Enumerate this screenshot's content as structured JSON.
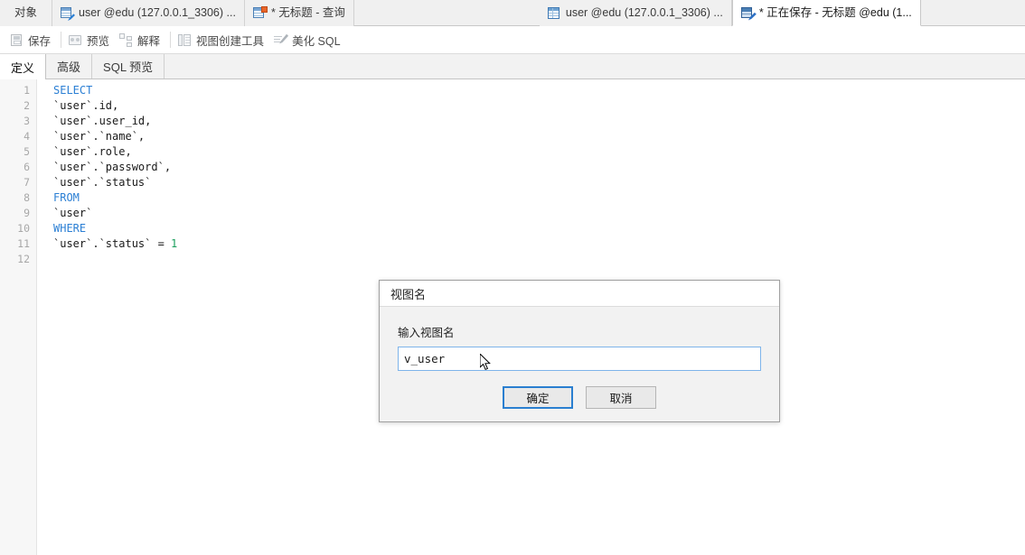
{
  "window": {
    "tabs": [
      {
        "label": "对象",
        "icon": "none",
        "active": false,
        "first": true
      },
      {
        "label": "user @edu (127.0.0.1_3306) ...",
        "icon": "table-pencil-icon",
        "active": false
      },
      {
        "label": "* 无标题 - 查询",
        "icon": "query-icon",
        "active": false
      },
      {
        "label": "user @edu (127.0.0.1_3306) ...",
        "icon": "table-icon",
        "active": false
      },
      {
        "label": "* 正在保存 - 无标题 @edu (1...",
        "icon": "saving-icon",
        "active": true
      }
    ]
  },
  "toolbar": {
    "items": [
      {
        "label": "保存",
        "icon": "save-icon"
      },
      {
        "label": "预览",
        "icon": "preview-icon"
      },
      {
        "label": "解释",
        "icon": "explain-icon"
      },
      {
        "label": "视图创建工具",
        "icon": "view-builder-icon"
      },
      {
        "label": "美化 SQL",
        "icon": "beautify-icon"
      }
    ]
  },
  "subtabs": [
    {
      "label": "定义",
      "active": true
    },
    {
      "label": "高级",
      "active": false
    },
    {
      "label": "SQL 预览",
      "active": false
    }
  ],
  "editor": {
    "line_numbers": [
      "1",
      "2",
      "3",
      "4",
      "5",
      "6",
      "7",
      "8",
      "9",
      "10",
      "11",
      "12"
    ],
    "lines": [
      {
        "text": "SELECT",
        "type": "keyword"
      },
      {
        "text": "`user`.id,",
        "type": "plain"
      },
      {
        "text": "`user`.user_id,",
        "type": "plain"
      },
      {
        "text": "`user`.`name`,",
        "type": "plain"
      },
      {
        "text": "`user`.role,",
        "type": "plain"
      },
      {
        "text": "`user`.`password`,",
        "type": "plain"
      },
      {
        "text": "`user`.`status`",
        "type": "plain"
      },
      {
        "text": "FROM",
        "type": "keyword"
      },
      {
        "text": "`user`",
        "type": "plain"
      },
      {
        "text": "WHERE",
        "type": "keyword"
      },
      {
        "text": "`user`.`status` = 1",
        "type": "mixed",
        "numeric": "1"
      },
      {
        "text": "",
        "type": "plain"
      }
    ],
    "full_sql": "SELECT\n`user`.id,\n`user`.user_id,\n`user`.`name`,\n`user`.role,\n`user`.`password`,\n`user`.`status`\nFROM\n`user`\nWHERE\n`user`.`status` = 1"
  },
  "dialog": {
    "title": "视图名",
    "label": "输入视图名",
    "input_value": "v_user",
    "input_placeholder": "",
    "ok_label": "确定",
    "cancel_label": "取消"
  },
  "colors": {
    "keyword": "#2b7fd4",
    "number": "#1a9e5c",
    "accent": "#2a7fd0",
    "input_border": "#7eb4ea",
    "tab_active_bg": "#ffffff",
    "chrome_bg": "#f0f0f0"
  }
}
